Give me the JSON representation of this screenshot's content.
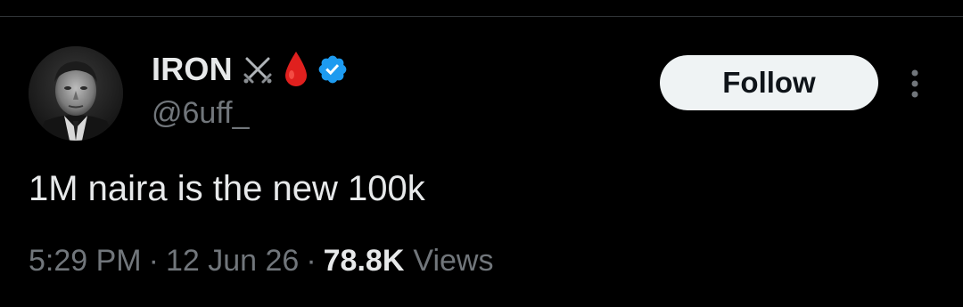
{
  "colors": {
    "background": "#000000",
    "text_primary": "#e7e9ea",
    "text_secondary": "#71767b",
    "verified_badge": "#1d9bf0",
    "follow_button_bg": "#eff3f4",
    "follow_button_text": "#0f1419",
    "blood_drop": "#e0201e"
  },
  "author": {
    "display_name": "IRON",
    "name_icons": [
      "crossed-swords-icon",
      "blood-drop-icon",
      "verified-badge-icon"
    ],
    "handle": "@6uff_",
    "avatar_icon": "avatar"
  },
  "actions": {
    "follow_label": "Follow",
    "more_icon": "more-vertical-icon"
  },
  "tweet": {
    "text": "1M naira is the new 100k"
  },
  "meta": {
    "time": "5:29 PM",
    "separator": "·",
    "date": "12 Jun 26",
    "views_count": "78.8K",
    "views_label": "Views"
  }
}
